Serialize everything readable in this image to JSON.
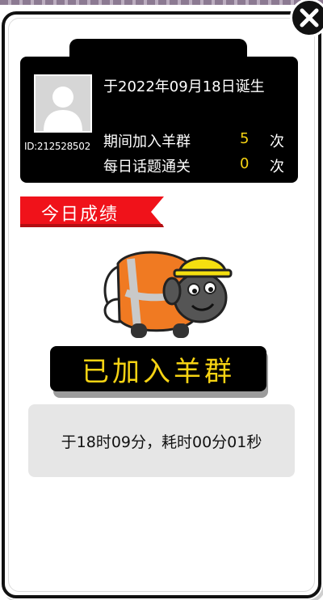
{
  "top_strip": {
    "color": "#8c7a92"
  },
  "close": {
    "icon": "close-icon"
  },
  "profile": {
    "birth_text": "于2022年09月18日诞生",
    "user_id": "ID:212528502",
    "avatar_icon": "person-avatar-icon",
    "stats": [
      {
        "label": "期间加入羊群",
        "value": "5",
        "unit": "次"
      },
      {
        "label": "每日话题通关",
        "value": "0",
        "unit": "次"
      }
    ]
  },
  "today_section": {
    "ribbon_label": "今日成绩",
    "ribbon_color": "#f0121a"
  },
  "result": {
    "sheep_icon": "sheep-with-hardhat-icon",
    "status_label": "已加入羊群",
    "status_color": "#f6d313",
    "time_text": "于18时09分，耗时00分01秒"
  }
}
